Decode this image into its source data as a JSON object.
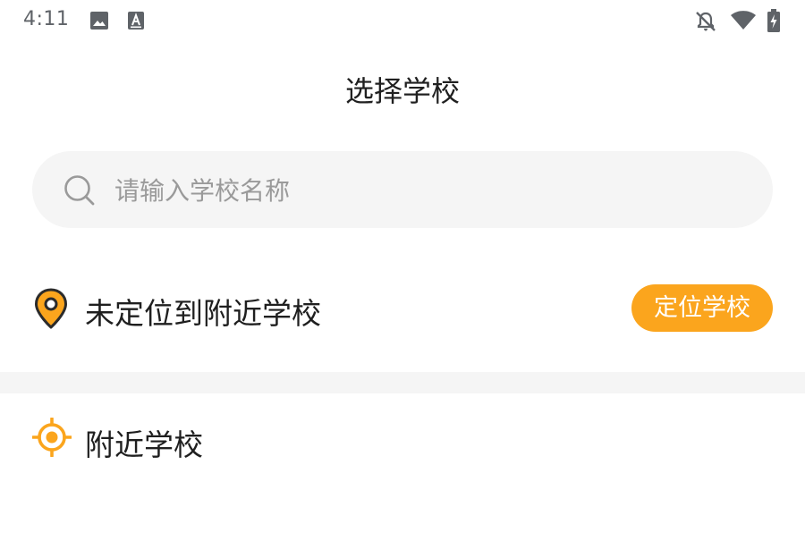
{
  "status_bar": {
    "time": "4:11",
    "icons": [
      "image-icon",
      "text-a-icon",
      "notifications-off-icon",
      "wifi-icon",
      "battery-charging-icon"
    ]
  },
  "header": {
    "title": "选择学校"
  },
  "search": {
    "placeholder": "请输入学校名称",
    "value": ""
  },
  "location": {
    "status_text": "未定位到附近学校",
    "button_label": "定位学校",
    "accent_color": "#fba51d"
  },
  "nearby": {
    "title": "附近学校"
  }
}
